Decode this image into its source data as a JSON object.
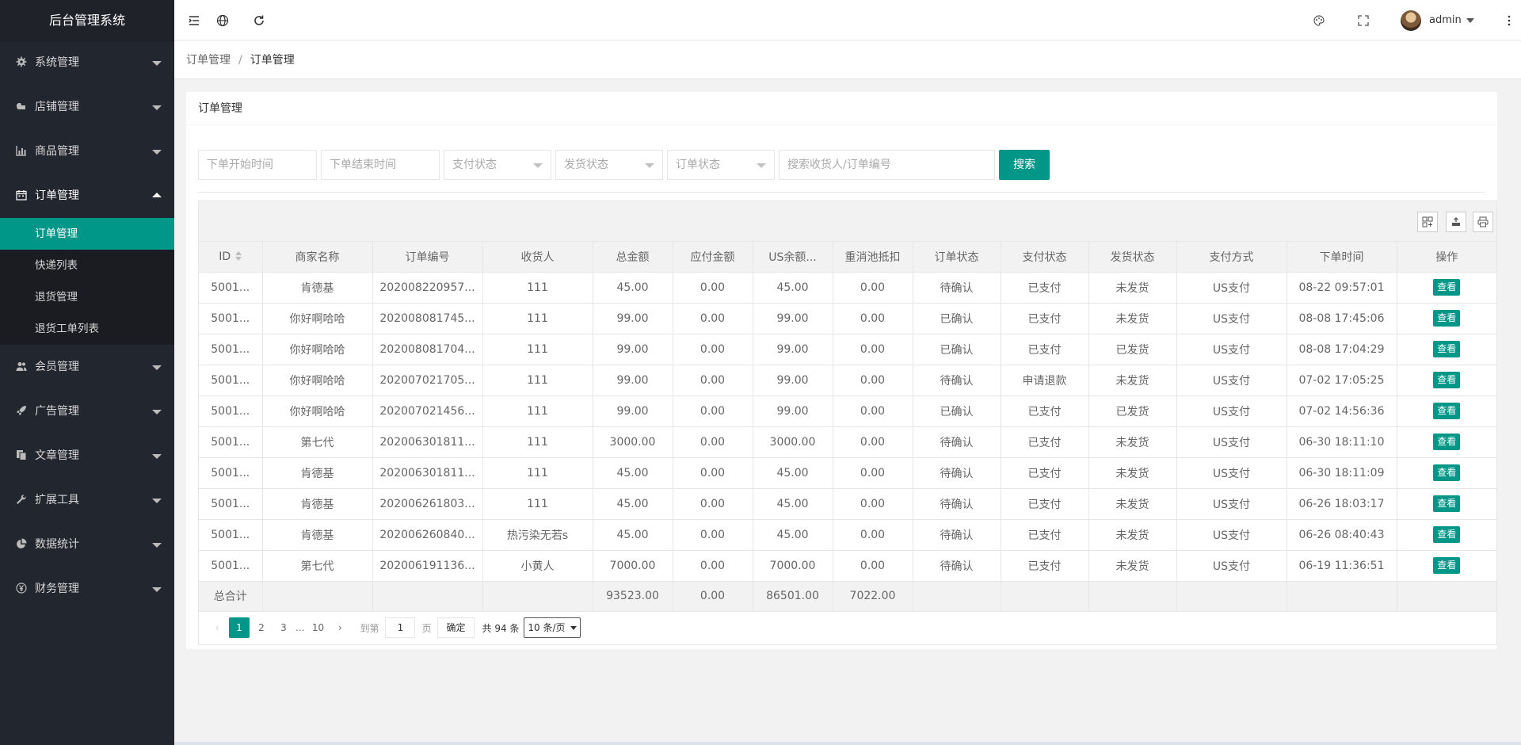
{
  "app": {
    "title": "后台管理系统"
  },
  "sidebar": {
    "groups": [
      {
        "label": "系统管理",
        "icon": "gear-icon"
      },
      {
        "label": "店铺管理",
        "icon": "shop-icon"
      },
      {
        "label": "商品管理",
        "icon": "bar-chart-icon"
      },
      {
        "label": "订单管理",
        "icon": "calendar-icon"
      },
      {
        "label": "会员管理",
        "icon": "users-icon"
      },
      {
        "label": "广告管理",
        "icon": "rocket-icon"
      },
      {
        "label": "文章管理",
        "icon": "copy-icon"
      },
      {
        "label": "扩展工具",
        "icon": "wrench-icon"
      },
      {
        "label": "数据统计",
        "icon": "pie-chart-icon"
      },
      {
        "label": "财务管理",
        "icon": "yen-icon"
      }
    ],
    "order_submenu": [
      {
        "label": "订单管理"
      },
      {
        "label": "快递列表"
      },
      {
        "label": "退货管理"
      },
      {
        "label": "退货工单列表"
      }
    ]
  },
  "header": {
    "user": "admin"
  },
  "breadcrumb": {
    "parent": "订单管理",
    "sep": "/",
    "current": "订单管理"
  },
  "card": {
    "title": "订单管理"
  },
  "filters": {
    "start_time": "下单开始时间",
    "end_time": "下单结束时间",
    "pay_status": "支付状态",
    "ship_status": "发货状态",
    "order_status": "订单状态",
    "keyword": "搜索收货人/订单编号",
    "search_label": "搜索"
  },
  "table": {
    "columns": [
      "ID",
      "商家名称",
      "订单编号",
      "收货人",
      "总金额",
      "应付金额",
      "US余额...",
      "重消池抵扣",
      "订单状态",
      "支付状态",
      "发货状态",
      "支付方式",
      "下单时间",
      "操作"
    ],
    "rows": [
      [
        "5001...",
        "肯德基",
        "202008220957...",
        "111",
        "45.00",
        "0.00",
        "45.00",
        "0.00",
        "待确认",
        "已支付",
        "未发货",
        "US支付",
        "08-22 09:57:01",
        "查看"
      ],
      [
        "5001...",
        "你好啊哈哈",
        "202008081745...",
        "111",
        "99.00",
        "0.00",
        "99.00",
        "0.00",
        "已确认",
        "已支付",
        "未发货",
        "US支付",
        "08-08 17:45:06",
        "查看"
      ],
      [
        "5001...",
        "你好啊哈哈",
        "202008081704...",
        "111",
        "99.00",
        "0.00",
        "99.00",
        "0.00",
        "已确认",
        "已支付",
        "已发货",
        "US支付",
        "08-08 17:04:29",
        "查看"
      ],
      [
        "5001...",
        "你好啊哈哈",
        "202007021705...",
        "111",
        "99.00",
        "0.00",
        "99.00",
        "0.00",
        "待确认",
        "申请退款",
        "未发货",
        "US支付",
        "07-02 17:05:25",
        "查看"
      ],
      [
        "5001...",
        "你好啊哈哈",
        "202007021456...",
        "111",
        "99.00",
        "0.00",
        "99.00",
        "0.00",
        "已确认",
        "已支付",
        "已发货",
        "US支付",
        "07-02 14:56:36",
        "查看"
      ],
      [
        "5001...",
        "第七代",
        "202006301811...",
        "111",
        "3000.00",
        "0.00",
        "3000.00",
        "0.00",
        "待确认",
        "已支付",
        "未发货",
        "US支付",
        "06-30 18:11:10",
        "查看"
      ],
      [
        "5001...",
        "肯德基",
        "202006301811...",
        "111",
        "45.00",
        "0.00",
        "45.00",
        "0.00",
        "待确认",
        "已支付",
        "未发货",
        "US支付",
        "06-30 18:11:09",
        "查看"
      ],
      [
        "5001...",
        "肯德基",
        "202006261803...",
        "111",
        "45.00",
        "0.00",
        "45.00",
        "0.00",
        "待确认",
        "已支付",
        "未发货",
        "US支付",
        "06-26 18:03:17",
        "查看"
      ],
      [
        "5001...",
        "肯德基",
        "202006260840...",
        "热污染无若s",
        "45.00",
        "0.00",
        "45.00",
        "0.00",
        "待确认",
        "已支付",
        "未发货",
        "US支付",
        "06-26 08:40:43",
        "查看"
      ],
      [
        "5001...",
        "第七代",
        "202006191136...",
        "小黄人",
        "7000.00",
        "0.00",
        "7000.00",
        "0.00",
        "待确认",
        "已支付",
        "未发货",
        "US支付",
        "06-19 11:36:51",
        "查看"
      ]
    ],
    "total": {
      "label": "总合计",
      "total_amount": "93523.00",
      "payable": "0.00",
      "us_balance": "86501.00",
      "pool_deduct": "7022.00"
    }
  },
  "pagination": {
    "pages": [
      "1",
      "2",
      "3",
      "...",
      "10"
    ],
    "current": "1",
    "goto_label": "到第",
    "goto_value": "1",
    "page_unit": "页",
    "confirm_label": "确定",
    "count_label": "共 94 条",
    "page_size": "10 条/页"
  },
  "colors": {
    "accent": "#009688",
    "sidebar_bg": "#22262e"
  }
}
